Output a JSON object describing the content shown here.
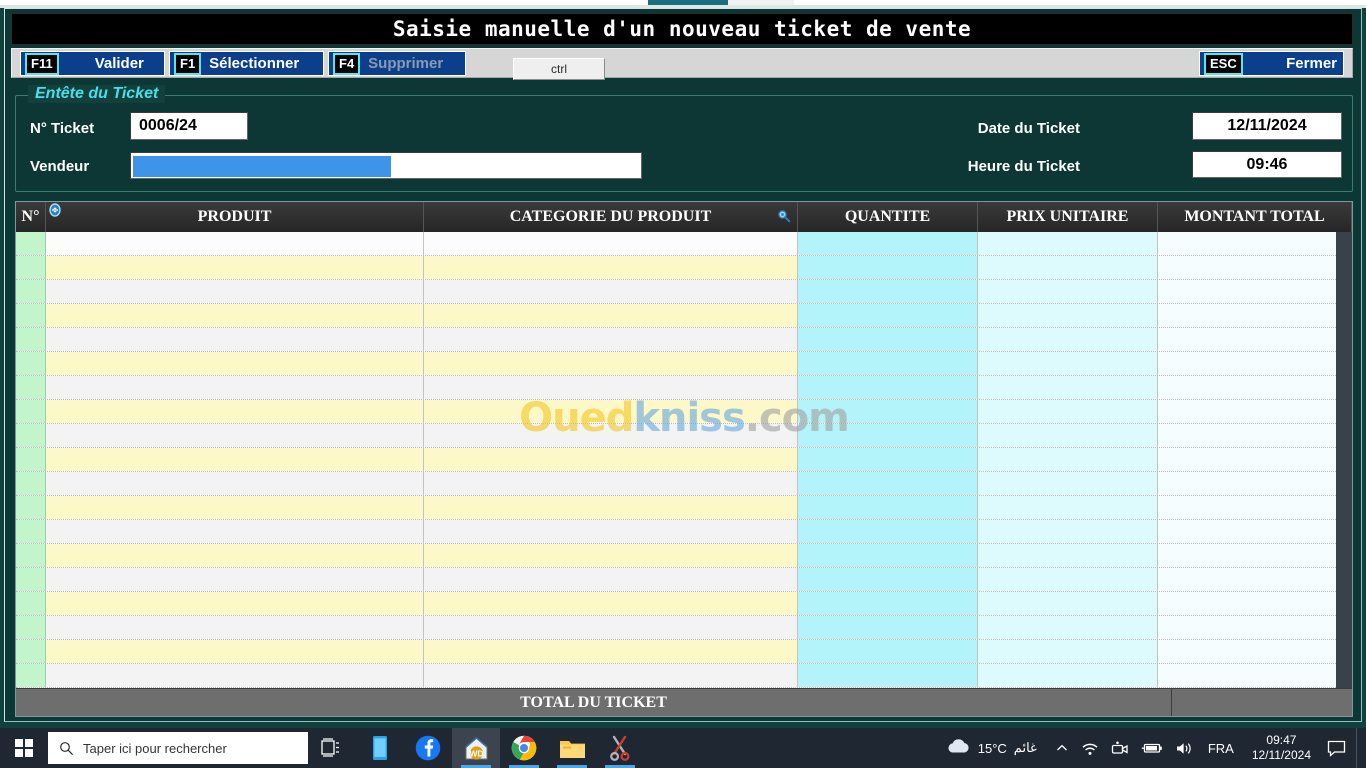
{
  "window": {
    "title": "Saisie manuelle d'un nouveau ticket de vente"
  },
  "toolbar": {
    "buttons": [
      {
        "key": "F11",
        "label": "Valider",
        "name": "valider",
        "disabled": false
      },
      {
        "key": "F1",
        "label": "Sélectionner",
        "name": "selectionner",
        "disabled": false
      },
      {
        "key": "F4",
        "label": "Supprimer",
        "name": "supprimer",
        "disabled": true
      }
    ],
    "ctrl_label": "ctrl",
    "close": {
      "key": "ESC",
      "label": "Fermer"
    }
  },
  "header_group": {
    "legend": "Entête du Ticket",
    "fields": {
      "no_ticket": {
        "label": "N° Ticket",
        "value": "0006/24"
      },
      "vendeur": {
        "label": "Vendeur",
        "value": "",
        "selected": true
      },
      "date_ticket": {
        "label": "Date du Ticket",
        "value": "12/11/2024"
      },
      "heure_ticket": {
        "label": "Heure du Ticket",
        "value": "09:46"
      }
    }
  },
  "table": {
    "columns": [
      {
        "key": "no",
        "label": "N°"
      },
      {
        "key": "prod",
        "label": "PRODUIT"
      },
      {
        "key": "cat",
        "label": "CATEGORIE DU PRODUIT"
      },
      {
        "key": "qte",
        "label": "QUANTITE"
      },
      {
        "key": "pu",
        "label": "PRIX UNITAIRE"
      },
      {
        "key": "mt",
        "label": "MONTANT TOTAL"
      }
    ],
    "header_icons": {
      "split": "split-handle-icon",
      "search": "search-icon"
    },
    "row_count": 19,
    "rows": [],
    "total": {
      "label": "TOTAL DU TICKET",
      "value": ""
    }
  },
  "watermark": {
    "part1": "Oued",
    "part2": "kniss",
    "part3": ".com"
  },
  "taskbar": {
    "start": "windows-start-icon",
    "search_placeholder": "Taper ici pour rechercher",
    "apps": [
      {
        "name": "task-view-icon",
        "label": "Task View"
      },
      {
        "name": "phone-link-icon",
        "label": "Votre téléphone"
      },
      {
        "name": "facebook-icon",
        "label": "Facebook"
      },
      {
        "name": "windev-icon",
        "label": "WinDev"
      },
      {
        "name": "google-chrome-icon",
        "label": "Google Chrome"
      },
      {
        "name": "file-explorer-icon",
        "label": "Explorateur de fichiers"
      },
      {
        "name": "snipping-tool-icon",
        "label": "Outil Capture d'écran"
      }
    ],
    "tray": {
      "weather_temp": "15°C",
      "weather_desc": "غائم",
      "language": "FRA",
      "time": "09:47",
      "date": "12/11/2024"
    }
  },
  "colors": {
    "app_background": "#12403d",
    "accent_cyan": "#45e0e8",
    "button_blue": "#0b3f8c",
    "header_dark": "#2e2e2e",
    "col_no": "#c2f5c9",
    "col_alt_yellow": "#fdf8c8",
    "col_qte_cyan": "#b2f4fa",
    "col_pu_cyan": "#ddfbfd",
    "total_grey": "#6e6e6e"
  }
}
